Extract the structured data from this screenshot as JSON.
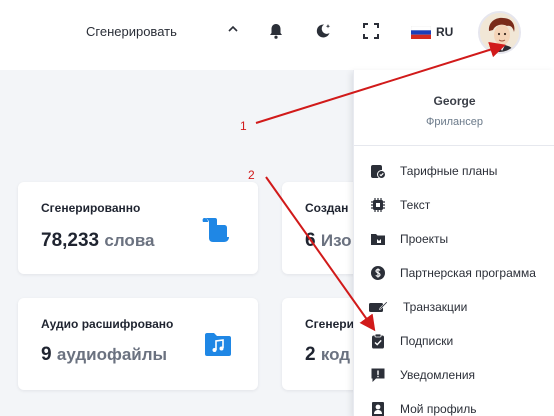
{
  "header": {
    "generate_label": "Сгенерировать",
    "language": "RU"
  },
  "cards": [
    {
      "label": "Сгенерированно",
      "value": "78,233",
      "unit": "слова",
      "icon": "document-icon"
    },
    {
      "label": "Создан",
      "value": "6",
      "unit": "Изо",
      "icon": "image-icon"
    },
    {
      "label": "Аудио расшифровано",
      "value": "9",
      "unit": "аудиофайлы",
      "icon": "music-folder-icon"
    },
    {
      "label": "Сгенери",
      "value": "2",
      "unit": "код",
      "icon": "code-icon"
    }
  ],
  "profile_menu": {
    "name": "George",
    "role": "Фрилансер",
    "items": [
      {
        "label": "Тарифные планы",
        "icon": "plans-icon"
      },
      {
        "label": "Текст",
        "icon": "chip-icon"
      },
      {
        "label": "Проекты",
        "icon": "folder-icon"
      },
      {
        "label": "Партнерская программа",
        "icon": "dollar-icon"
      },
      {
        "label": "Транзакции",
        "icon": "card-pen-icon"
      },
      {
        "label": "Подписки",
        "icon": "clipboard-check-icon"
      },
      {
        "label": "Уведомления",
        "icon": "alert-message-icon"
      },
      {
        "label": "Мой профиль",
        "icon": "profile-icon"
      }
    ]
  },
  "annotations": {
    "first": "1",
    "second": "2",
    "color": "#d11a1a"
  }
}
